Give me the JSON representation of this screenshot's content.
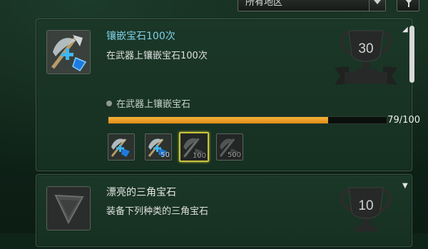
{
  "filter_bar": {
    "region_dropdown_value": "所有地区",
    "colors": {
      "accent_title": "#7fd0e8",
      "progress": "#eea22a",
      "selected_reward_border": "#c9c23a"
    }
  },
  "achievements": [
    {
      "title": "镶嵌宝石100次",
      "description": "在武器上镶嵌宝石100次",
      "points": "30",
      "icon": "weapon-gem-socket-icon",
      "criteria": "在武器上镶嵌宝石",
      "progress_text": "79/100",
      "progress_fraction": 0.79,
      "rewards": [
        {
          "label": "",
          "state": "unlocked",
          "icon": "weapon-gem-icon"
        },
        {
          "label": "50",
          "state": "unlocked",
          "icon": "weapon-gem-icon"
        },
        {
          "label": "100",
          "state": "current",
          "icon": "weapon-gem-icon"
        },
        {
          "label": "500",
          "state": "locked",
          "icon": "weapon-gem-icon"
        }
      ]
    },
    {
      "title": "漂亮的三角宝石",
      "description": "装备下列种类的三角宝石",
      "points": "10",
      "icon": "triangle-gem-icon"
    }
  ]
}
